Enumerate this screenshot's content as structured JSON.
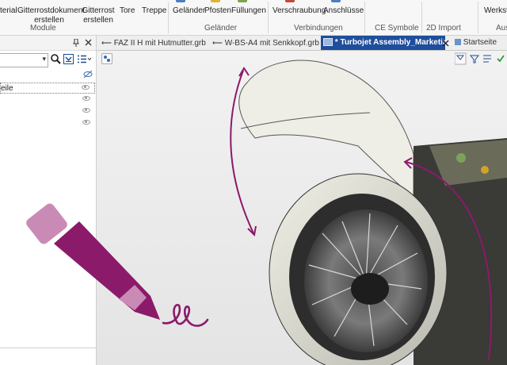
{
  "ribbon": {
    "buttons": [
      "terial",
      "Gitterrostdokument\nerstellen",
      "Gitterrost\nerstellen",
      "Tore",
      "Treppe",
      "Geländer",
      "Pfosten",
      "Füllungen",
      "Verschraubung",
      "Anschlüsse",
      "Werkst"
    ],
    "groups": {
      "module": "Module",
      "gelaender": "Geländer",
      "verbindungen": "Verbindungen",
      "ce": "CE Symbole",
      "import2d": "2D Import",
      "aus": "Aus"
    }
  },
  "tabs": [
    {
      "label": "FAZ II H mit Hutmutter.grb",
      "active": false
    },
    {
      "label": "W-BS-A4 mit Senkkopf.grb",
      "active": false
    },
    {
      "label": "* Turbojet Assembly_Marketin...",
      "active": true
    },
    {
      "label": "Startseite",
      "active": false
    }
  ],
  "tree": {
    "first_item": "eile"
  },
  "colors": {
    "accent": "#1f4e9c",
    "annotation": "#8b1a6b",
    "annotation_light": "#c98bb5"
  },
  "icons": [
    "pin-icon",
    "close-icon",
    "search-icon",
    "filter-icon",
    "list-icon",
    "eye-icon",
    "pencil-icon",
    "check-icon"
  ]
}
